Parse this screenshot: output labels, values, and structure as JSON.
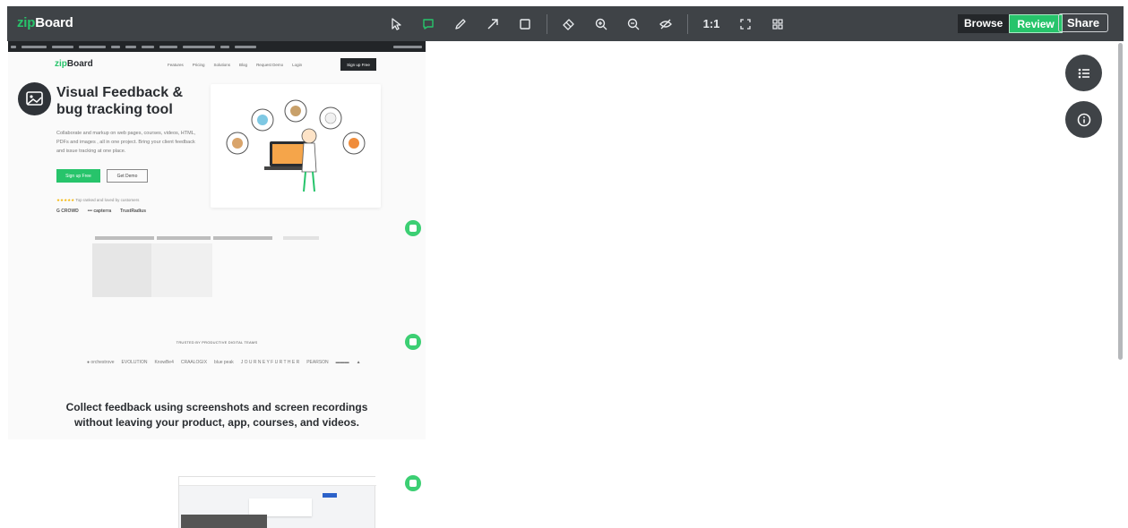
{
  "app": {
    "logo_zip": "zip",
    "logo_board": "Board",
    "zoom_label": "1:1",
    "mode_browse": "Browse",
    "mode_review": "Review",
    "share_label": "Share",
    "accent_color": "#27c46b",
    "toolbar_color": "#3f4347"
  },
  "toolbar_icons": [
    "cursor-icon",
    "comment-icon",
    "pencil-icon",
    "arrow-icon",
    "rectangle-icon",
    "eraser-icon",
    "zoom-in-icon",
    "zoom-out-icon",
    "hide-icon",
    "fit-screen-icon",
    "grid-icon"
  ],
  "site": {
    "logo_zip": "zip",
    "logo_board": "Board",
    "nav": [
      "Features",
      "Pricing",
      "Solutions",
      "Blog",
      "Request Demo",
      "Login"
    ],
    "cta": "Sign up Free",
    "hero_title": "Visual Feedback & bug tracking tool",
    "hero_desc": "Collaborate and markup on web pages, courses, videos, HTML, PDFs and images , all in one project. Bring your client feedback and issue tracking at one place.",
    "hero_signup": "Sign up Free",
    "hero_demo": "Get Demo",
    "stars": "★★★★★",
    "rated_text": "Top ranked and loved by customers",
    "badges": [
      "G CROWD",
      "••• capterra",
      "TrustRadius"
    ],
    "trusted": "TRUSTED BY PRODUCTIVE DIGITAL TEAMS",
    "partner_logos": [
      "● orchestrove",
      "EVOLUTION",
      "KnowBe4",
      "CRAALOGIX",
      "blue peak",
      "J O U R N E Y  F U R T H E R",
      "PEARSON",
      "▬▬▬",
      "▲"
    ],
    "collect_line1": "Collect feedback using screenshots and screen recordings",
    "collect_line2": "without leaving your product, app, courses, and videos."
  },
  "side_buttons": [
    "list-icon",
    "info-icon"
  ]
}
